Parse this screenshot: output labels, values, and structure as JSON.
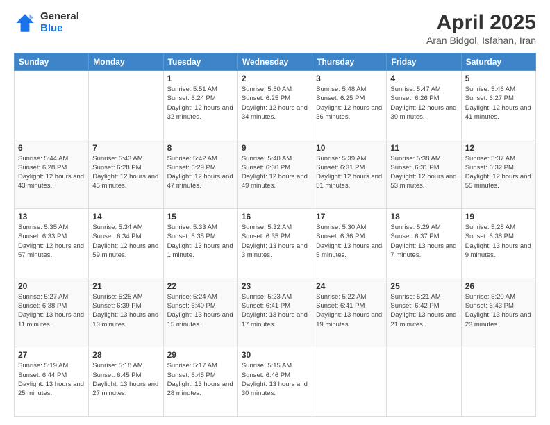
{
  "logo": {
    "general": "General",
    "blue": "Blue"
  },
  "header": {
    "month": "April 2025",
    "location": "Aran Bidgol, Isfahan, Iran"
  },
  "days_of_week": [
    "Sunday",
    "Monday",
    "Tuesday",
    "Wednesday",
    "Thursday",
    "Friday",
    "Saturday"
  ],
  "weeks": [
    [
      {
        "day": "",
        "info": ""
      },
      {
        "day": "",
        "info": ""
      },
      {
        "day": "1",
        "info": "Sunrise: 5:51 AM\nSunset: 6:24 PM\nDaylight: 12 hours and 32 minutes."
      },
      {
        "day": "2",
        "info": "Sunrise: 5:50 AM\nSunset: 6:25 PM\nDaylight: 12 hours and 34 minutes."
      },
      {
        "day": "3",
        "info": "Sunrise: 5:48 AM\nSunset: 6:25 PM\nDaylight: 12 hours and 36 minutes."
      },
      {
        "day": "4",
        "info": "Sunrise: 5:47 AM\nSunset: 6:26 PM\nDaylight: 12 hours and 39 minutes."
      },
      {
        "day": "5",
        "info": "Sunrise: 5:46 AM\nSunset: 6:27 PM\nDaylight: 12 hours and 41 minutes."
      }
    ],
    [
      {
        "day": "6",
        "info": "Sunrise: 5:44 AM\nSunset: 6:28 PM\nDaylight: 12 hours and 43 minutes."
      },
      {
        "day": "7",
        "info": "Sunrise: 5:43 AM\nSunset: 6:28 PM\nDaylight: 12 hours and 45 minutes."
      },
      {
        "day": "8",
        "info": "Sunrise: 5:42 AM\nSunset: 6:29 PM\nDaylight: 12 hours and 47 minutes."
      },
      {
        "day": "9",
        "info": "Sunrise: 5:40 AM\nSunset: 6:30 PM\nDaylight: 12 hours and 49 minutes."
      },
      {
        "day": "10",
        "info": "Sunrise: 5:39 AM\nSunset: 6:31 PM\nDaylight: 12 hours and 51 minutes."
      },
      {
        "day": "11",
        "info": "Sunrise: 5:38 AM\nSunset: 6:31 PM\nDaylight: 12 hours and 53 minutes."
      },
      {
        "day": "12",
        "info": "Sunrise: 5:37 AM\nSunset: 6:32 PM\nDaylight: 12 hours and 55 minutes."
      }
    ],
    [
      {
        "day": "13",
        "info": "Sunrise: 5:35 AM\nSunset: 6:33 PM\nDaylight: 12 hours and 57 minutes."
      },
      {
        "day": "14",
        "info": "Sunrise: 5:34 AM\nSunset: 6:34 PM\nDaylight: 12 hours and 59 minutes."
      },
      {
        "day": "15",
        "info": "Sunrise: 5:33 AM\nSunset: 6:35 PM\nDaylight: 13 hours and 1 minute."
      },
      {
        "day": "16",
        "info": "Sunrise: 5:32 AM\nSunset: 6:35 PM\nDaylight: 13 hours and 3 minutes."
      },
      {
        "day": "17",
        "info": "Sunrise: 5:30 AM\nSunset: 6:36 PM\nDaylight: 13 hours and 5 minutes."
      },
      {
        "day": "18",
        "info": "Sunrise: 5:29 AM\nSunset: 6:37 PM\nDaylight: 13 hours and 7 minutes."
      },
      {
        "day": "19",
        "info": "Sunrise: 5:28 AM\nSunset: 6:38 PM\nDaylight: 13 hours and 9 minutes."
      }
    ],
    [
      {
        "day": "20",
        "info": "Sunrise: 5:27 AM\nSunset: 6:38 PM\nDaylight: 13 hours and 11 minutes."
      },
      {
        "day": "21",
        "info": "Sunrise: 5:25 AM\nSunset: 6:39 PM\nDaylight: 13 hours and 13 minutes."
      },
      {
        "day": "22",
        "info": "Sunrise: 5:24 AM\nSunset: 6:40 PM\nDaylight: 13 hours and 15 minutes."
      },
      {
        "day": "23",
        "info": "Sunrise: 5:23 AM\nSunset: 6:41 PM\nDaylight: 13 hours and 17 minutes."
      },
      {
        "day": "24",
        "info": "Sunrise: 5:22 AM\nSunset: 6:41 PM\nDaylight: 13 hours and 19 minutes."
      },
      {
        "day": "25",
        "info": "Sunrise: 5:21 AM\nSunset: 6:42 PM\nDaylight: 13 hours and 21 minutes."
      },
      {
        "day": "26",
        "info": "Sunrise: 5:20 AM\nSunset: 6:43 PM\nDaylight: 13 hours and 23 minutes."
      }
    ],
    [
      {
        "day": "27",
        "info": "Sunrise: 5:19 AM\nSunset: 6:44 PM\nDaylight: 13 hours and 25 minutes."
      },
      {
        "day": "28",
        "info": "Sunrise: 5:18 AM\nSunset: 6:45 PM\nDaylight: 13 hours and 27 minutes."
      },
      {
        "day": "29",
        "info": "Sunrise: 5:17 AM\nSunset: 6:45 PM\nDaylight: 13 hours and 28 minutes."
      },
      {
        "day": "30",
        "info": "Sunrise: 5:15 AM\nSunset: 6:46 PM\nDaylight: 13 hours and 30 minutes."
      },
      {
        "day": "",
        "info": ""
      },
      {
        "day": "",
        "info": ""
      },
      {
        "day": "",
        "info": ""
      }
    ]
  ]
}
